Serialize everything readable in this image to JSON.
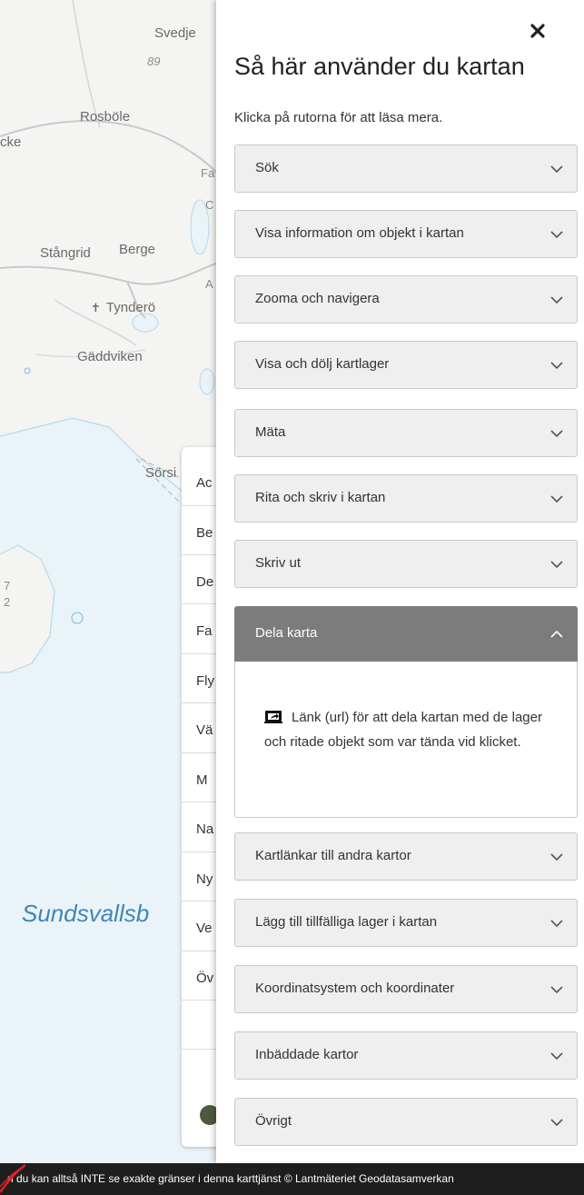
{
  "map": {
    "place_labels": [
      {
        "id": "svedje",
        "text": "Svedje"
      },
      {
        "id": "road89",
        "text": "89"
      },
      {
        "id": "rosbole",
        "text": "Rosböle"
      },
      {
        "id": "cke",
        "text": "cke"
      },
      {
        "id": "fa",
        "text": "Fa"
      },
      {
        "id": "c",
        "text": "C"
      },
      {
        "id": "stangrid",
        "text": "Stångrid"
      },
      {
        "id": "berge",
        "text": "Berge"
      },
      {
        "id": "a",
        "text": "A"
      },
      {
        "id": "tyndero",
        "text": "Tynderö"
      },
      {
        "id": "gaddviken",
        "text": "Gäddviken"
      },
      {
        "id": "sorsi",
        "text": "Sörsi"
      },
      {
        "id": "seven",
        "text": "7"
      },
      {
        "id": "two",
        "text": "2"
      }
    ],
    "water_label": "Sundsvallsb"
  },
  "hidden_list": {
    "items": [
      "Ac",
      "Be",
      "De",
      "Fa",
      "Fly",
      "Vä",
      "M",
      "Na",
      "Ny",
      "Ve",
      "Öv"
    ]
  },
  "help_panel": {
    "close_icon": "close-icon",
    "title": "Så här använder du kartan",
    "intro": "Klicka på rutorna för att läsa mera.",
    "sections": [
      {
        "label": "Sök",
        "expanded": false
      },
      {
        "label": "Visa information om objekt i kartan",
        "expanded": false
      },
      {
        "label": "Zooma och navigera",
        "expanded": false
      },
      {
        "label": "Visa och dölj kartlager",
        "expanded": false
      },
      {
        "label": "Mäta",
        "expanded": false
      },
      {
        "label": "Rita och skriv i kartan",
        "expanded": false
      },
      {
        "label": "Skriv ut",
        "expanded": false
      },
      {
        "label": "Dela karta",
        "expanded": true
      },
      {
        "label": "Kartlänkar till andra kartor",
        "expanded": false
      },
      {
        "label": "Lägg till tillfälliga lager i kartan",
        "expanded": false
      },
      {
        "label": "Koordinatsystem och koordinater",
        "expanded": false
      },
      {
        "label": "Inbäddade kartor",
        "expanded": false
      },
      {
        "label": "Övrigt",
        "expanded": false
      }
    ],
    "share_content": {
      "icon": "share-link-icon",
      "text": "Länk (url) för att dela kartan med de lager och ritade objekt som var tända vid klicket."
    }
  },
  "attribution": {
    "text": "n du kan alltså INTE se exakte gränser i denna karttjänst © Lantmäteriet Geodatasamverkan"
  },
  "colors": {
    "panel_header_open": "#7c7c7c",
    "accordion_bg": "#efefef",
    "water_text": "#3f86b8",
    "attribution_bg": "#1e1e1e"
  }
}
